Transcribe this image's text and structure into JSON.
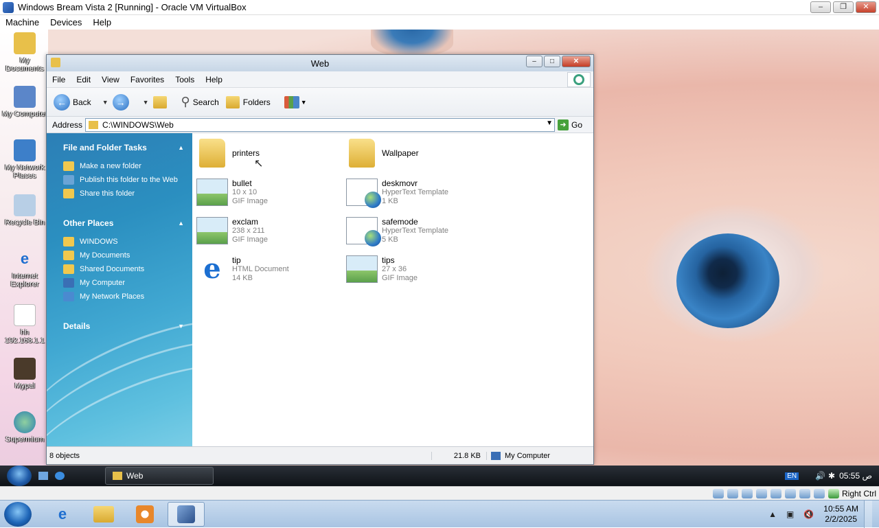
{
  "host": {
    "title": "Windows Bream Vista 2 [Running] - Oracle VM VirtualBox",
    "menu": [
      "Machine",
      "Devices",
      "Help"
    ],
    "window_buttons": [
      "minimize",
      "restore",
      "close"
    ],
    "status_hostkey": "Right Ctrl",
    "taskbar_clock_time": "10:55 AM",
    "taskbar_clock_date": "2/2/2025"
  },
  "desktop_icons": [
    {
      "label": "My Documents",
      "icon": "folder-icon"
    },
    {
      "label": "My Computer",
      "icon": "computer-icon"
    },
    {
      "label": "My Network Places",
      "icon": "network-icon"
    },
    {
      "label": "Recycle Bin",
      "icon": "recycle-bin-icon"
    },
    {
      "label": "Internet Explorer",
      "icon": "ie-icon"
    },
    {
      "label": "hh 192.168.1.1",
      "icon": "file-icon"
    },
    {
      "label": "Mypal",
      "icon": "mypal-icon"
    },
    {
      "label": "Supermium",
      "icon": "browser-icon"
    }
  ],
  "explorer": {
    "title": "Web",
    "menu": [
      "File",
      "Edit",
      "View",
      "Favorites",
      "Tools",
      "Help"
    ],
    "toolbar": {
      "back": "Back",
      "search": "Search",
      "folders": "Folders"
    },
    "address_label": "Address",
    "address_value": "C:\\WINDOWS\\Web",
    "go_label": "Go",
    "tasks": {
      "file_folder_title": "File and Folder Tasks",
      "file_folder_items": [
        "Make a new folder",
        "Publish this folder to the Web",
        "Share this folder"
      ],
      "other_places_title": "Other Places",
      "other_places_items": [
        "WINDOWS",
        "My Documents",
        "Shared Documents",
        "My Computer",
        "My Network Places"
      ],
      "details_title": "Details"
    },
    "files": [
      {
        "name": "printers",
        "type": "folder",
        "line1": "",
        "line2": ""
      },
      {
        "name": "Wallpaper",
        "type": "folder",
        "line1": "",
        "line2": ""
      },
      {
        "name": "bullet",
        "type": "gif",
        "line1": "10 x 10",
        "line2": "GIF Image"
      },
      {
        "name": "deskmovr",
        "type": "htt",
        "line1": "HyperText Template",
        "line2": "1 KB"
      },
      {
        "name": "exclam",
        "type": "gif",
        "line1": "238 x 211",
        "line2": "GIF Image"
      },
      {
        "name": "safemode",
        "type": "htt",
        "line1": "HyperText Template",
        "line2": "5 KB"
      },
      {
        "name": "tip",
        "type": "html",
        "line1": "HTML Document",
        "line2": "14 KB"
      },
      {
        "name": "tips",
        "type": "gif",
        "line1": "27 x 36",
        "line2": "GIF Image"
      }
    ],
    "status": {
      "count": "8 objects",
      "size": "21.8 KB",
      "location": "My Computer"
    }
  },
  "guest_taskbar": {
    "task_button": "Web",
    "language": "EN",
    "time": "05:55 ص"
  }
}
